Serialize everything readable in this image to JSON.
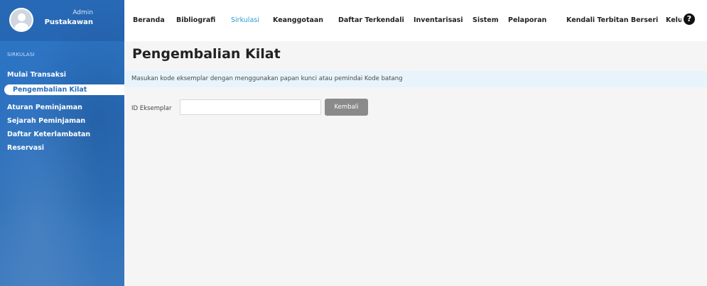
{
  "user": {
    "role": "Admin",
    "name": "Pustakawan"
  },
  "sidebar": {
    "section": "SIRKULASI",
    "items": [
      {
        "label": "Mulai Transaksi"
      },
      {
        "label": "Pengembalian Kilat",
        "active": true
      },
      {
        "label": "Aturan Peminjaman"
      },
      {
        "label": "Sejarah Peminjaman"
      },
      {
        "label": "Daftar Keterlambatan"
      },
      {
        "label": "Reservasi"
      }
    ]
  },
  "nav": {
    "items": [
      {
        "label": "Beranda"
      },
      {
        "label": "Bibliografi"
      },
      {
        "label": "Sirkulasi",
        "active": true
      },
      {
        "label": "Keanggotaan"
      },
      {
        "label": "Daftar Terkendali"
      },
      {
        "label": "Inventarisasi"
      },
      {
        "label": "Sistem"
      },
      {
        "label": "Pelaporan"
      },
      {
        "label": "Kendali Terbitan Berseri"
      },
      {
        "label": "Kelu"
      }
    ],
    "help_icon": "?"
  },
  "main": {
    "title": "Pengembalian Kilat",
    "info": "Masukan kode eksemplar dengan menggunakan papan kunci atau pemindai Kode batang",
    "field_label": "ID Eksemplar",
    "field_value": "",
    "field_placeholder": "",
    "submit_label": "Kembali"
  },
  "colors": {
    "sidebar": "#2a6fbf",
    "accent": "#2d9bd6",
    "info_bg": "#e8f4fc",
    "button": "#8a8a8a"
  }
}
